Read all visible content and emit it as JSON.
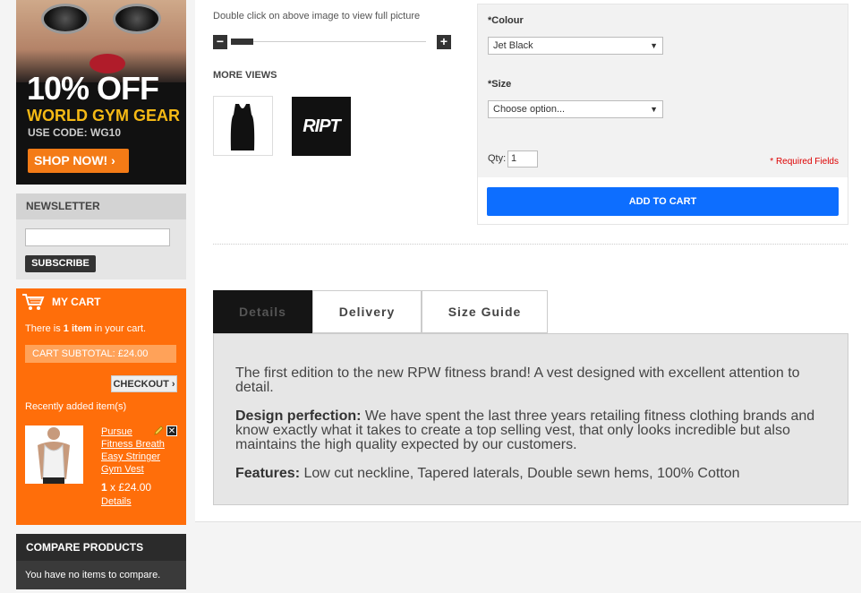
{
  "promo": {
    "headline": "10% OFF",
    "subhead": "WORLD GYM GEAR",
    "code_label": "USE CODE: WG10",
    "button": "SHOP NOW! ›"
  },
  "newsletter": {
    "title": "NEWSLETTER",
    "email_value": "",
    "subscribe": "SUBSCRIBE"
  },
  "cart": {
    "title": "MY CART",
    "info_prefix": "There is ",
    "info_count": "1 item",
    "info_suffix": " in your cart.",
    "subtotal": "CART SUBTOTAL: £24.00",
    "checkout": "CHECKOUT ›",
    "recent": "Recently added item(s)",
    "item_name": "Pursue Fitness Breath Easy Stringer Gym Vest",
    "item_qty": "1",
    "item_qty_sep": " x ",
    "item_price": "£24.00",
    "item_details": "Details",
    "delete_glyph": "✕"
  },
  "compare": {
    "title": "COMPARE PRODUCTS",
    "empty": "You have no items to compare."
  },
  "gallery": {
    "hint": "Double click on above image to view  full picture",
    "zoom_out": "−",
    "zoom_in": "+",
    "more_views": "MORE VIEWS",
    "thumb2_text": "RIPT"
  },
  "options": {
    "colour_label": "*Colour",
    "colour_value": "Jet Black",
    "size_label": "*Size",
    "size_value": "Choose option...",
    "dropdown_arrow": "▼",
    "qty_label": "Qty:",
    "qty_value": "1",
    "required": "* Required Fields",
    "add_to_cart": "ADD TO CART"
  },
  "tabs": [
    {
      "label": "Details"
    },
    {
      "label": "Delivery"
    },
    {
      "label": "Size Guide"
    }
  ],
  "details": {
    "intro": "The first edition to the new RPW fitness brand! A vest designed with excellent attention to detail.",
    "p2_title": "Design perfection:",
    "p2_body": " We have spent the last three years retailing fitness clothing brands and know exactly what it takes to create a top selling vest, that only looks incredible but also maintains the high quality expected by our customers.",
    "p3_title": "Features:",
    "p3_body": " Low cut neckline, Tapered laterals, Double sewn hems, 100% Cotton"
  },
  "colors": {
    "cart_orange": "#ff6e0a",
    "add_to_cart_blue": "#0d6eff",
    "promo_yellow": "#f5b915",
    "required_red": "#dd0000"
  }
}
